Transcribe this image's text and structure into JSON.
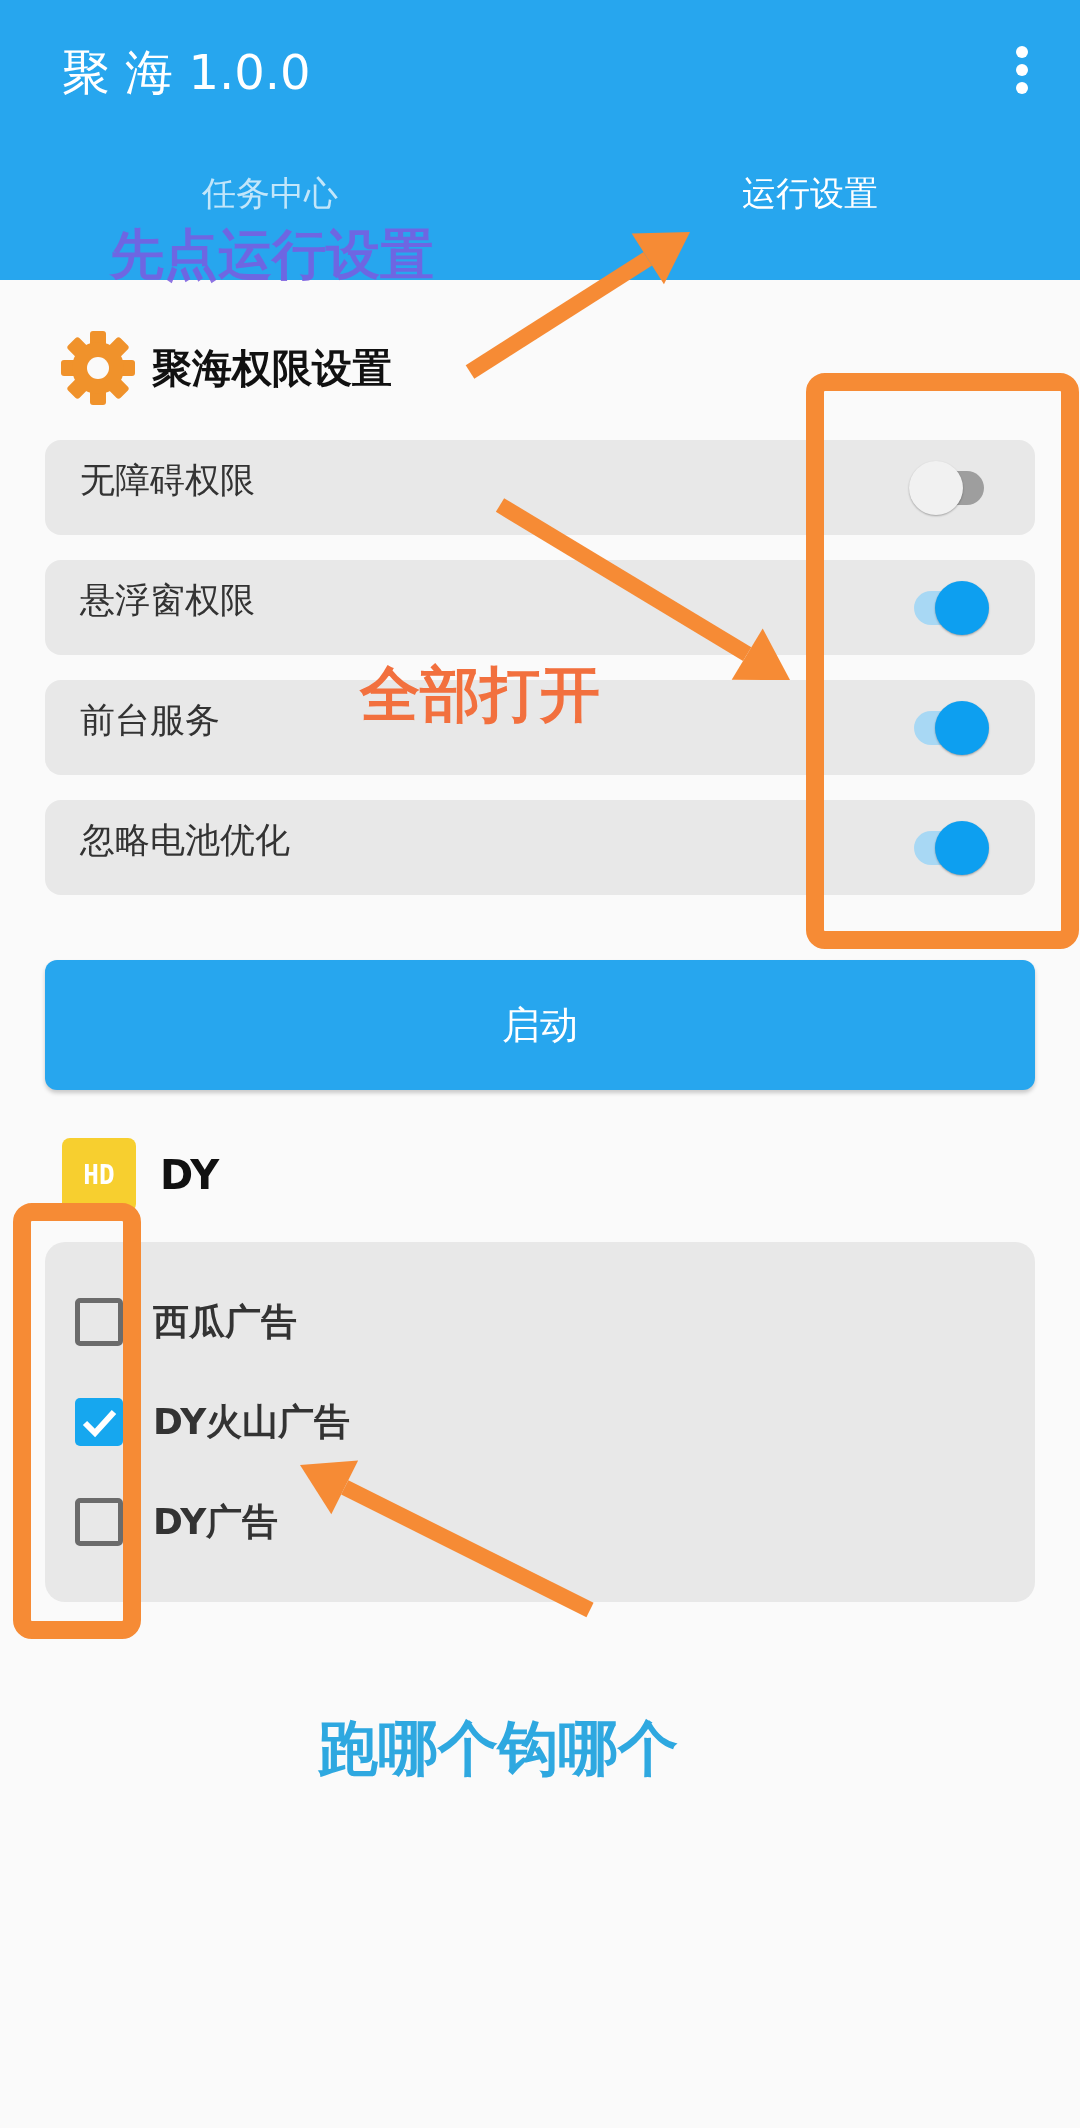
{
  "app_bar": {
    "title": "聚 海 1.0.0"
  },
  "tabs": [
    {
      "label": "任务中心",
      "selected": false
    },
    {
      "label": "运行设置",
      "selected": true
    }
  ],
  "permissions": {
    "title": "聚海权限设置",
    "items": [
      {
        "label": "无障碍权限",
        "on": false
      },
      {
        "label": "悬浮窗权限",
        "on": true
      },
      {
        "label": "前台服务",
        "on": true
      },
      {
        "label": "忽略电池优化",
        "on": true
      }
    ]
  },
  "start_button": "启动",
  "dy_section": {
    "icon_text": "HD",
    "title": "DY",
    "items": [
      {
        "label": "西瓜广告",
        "checked": false
      },
      {
        "label": "DY火山广告",
        "checked": true
      },
      {
        "label": "DY广告",
        "checked": false
      }
    ]
  },
  "annotations": [
    {
      "kind": "label",
      "text": "先点运行设置",
      "color": "#7b5ce0"
    },
    {
      "kind": "arrow"
    },
    {
      "kind": "frame"
    },
    {
      "kind": "arrow"
    },
    {
      "kind": "label",
      "text": "全部打开",
      "color": "#f2703e"
    },
    {
      "kind": "frame"
    },
    {
      "kind": "arrow"
    },
    {
      "kind": "label",
      "text": "跑哪个钩哪个",
      "color": "#2ea8e0"
    }
  ]
}
